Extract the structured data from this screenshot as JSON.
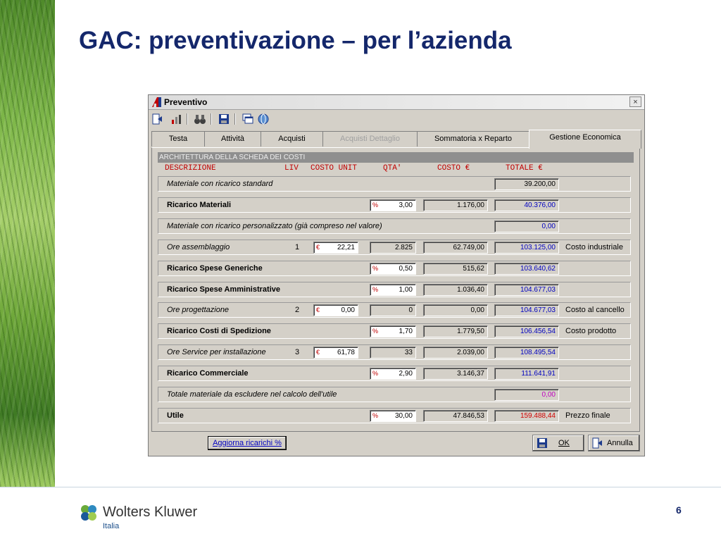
{
  "slide": {
    "title": "GAC: preventivazione – per l’azienda",
    "page_number": "6",
    "logo": {
      "name": "Wolters Kluwer",
      "subtitle": "Italia"
    }
  },
  "window": {
    "title": "Preventivo",
    "close_label": "×",
    "toolbar_icons": [
      "exit-icon",
      "chart-icon",
      "binoculars-icon",
      "save-icon",
      "windows-icon",
      "globe-icon"
    ]
  },
  "tabs": [
    {
      "label": "Testa",
      "state": "normal"
    },
    {
      "label": "Attività",
      "state": "normal"
    },
    {
      "label": "Acquisti",
      "state": "normal"
    },
    {
      "label": "Acquisti Dettaglio",
      "state": "disabled"
    },
    {
      "label": "Sommatoria x Reparto",
      "state": "normal"
    },
    {
      "label": "Gestione Economica",
      "state": "active"
    }
  ],
  "section": {
    "title": "ARCHITETTURA DELLA SCHEDA DEI COSTI",
    "headers": {
      "descrizione": "DESCRIZIONE",
      "liv": "LIV",
      "costo_unit": "COSTO UNIT",
      "qta": "QTA'",
      "costo": "COSTO €",
      "totale": "TOTALE €"
    }
  },
  "rows": [
    {
      "label": "Materiale con ricarico standard",
      "style": "italic",
      "totale": "39.200,00",
      "totale_color": "black"
    },
    {
      "label": "Ricarico Materiali",
      "style": "bold",
      "unit": "%",
      "qta": "3,00",
      "costo": "1.176,00",
      "totale": "40.376,00",
      "totale_color": "blue"
    },
    {
      "label": "Materiale con ricarico personalizzato (già compreso nel valore)",
      "style": "italic",
      "totale": "0,00",
      "totale_color": "blue"
    },
    {
      "label": "Ore assemblaggio",
      "style": "italic",
      "liv": "1",
      "unit": "€",
      "costo_unit": "22,21",
      "qta": "2.825",
      "costo": "62.749,00",
      "totale": "103.125,00",
      "totale_color": "blue",
      "note": "Costo industriale"
    },
    {
      "label": "Ricarico Spese Generiche",
      "style": "bold",
      "unit": "%",
      "qta": "0,50",
      "costo": "515,62",
      "totale": "103.640,62",
      "totale_color": "blue"
    },
    {
      "label": "Ricarico Spese Amministrative",
      "style": "bold",
      "unit": "%",
      "qta": "1,00",
      "costo": "1.036,40",
      "totale": "104.677,03",
      "totale_color": "blue"
    },
    {
      "label": "Ore progettazione",
      "style": "italic",
      "liv": "2",
      "unit": "€",
      "costo_unit": "0,00",
      "qta": "0",
      "costo": "0,00",
      "totale": "104.677,03",
      "totale_color": "blue",
      "note": "Costo al cancello"
    },
    {
      "label": "Ricarico Costi di Spedizione",
      "style": "bold",
      "unit": "%",
      "qta": "1,70",
      "costo": "1.779,50",
      "totale": "106.456,54",
      "totale_color": "blue",
      "note": "Costo prodotto"
    },
    {
      "label": "Ore Service per installazione",
      "style": "italic",
      "liv": "3",
      "unit": "€",
      "costo_unit": "61,78",
      "qta": "33",
      "costo": "2.039,00",
      "totale": "108.495,54",
      "totale_color": "blue"
    },
    {
      "label": "Ricarico Commerciale",
      "style": "bold",
      "unit": "%",
      "qta": "2,90",
      "costo": "3.146,37",
      "totale": "111.641,91",
      "totale_color": "blue"
    },
    {
      "label": "Totale materiale da escludere nel calcolo dell'utile",
      "style": "italic",
      "totale": "0,00",
      "totale_color": "magenta"
    },
    {
      "label": "Utile",
      "style": "bold",
      "unit": "%",
      "qta": "30,00",
      "costo": "47.846,53",
      "totale": "159.488,44",
      "totale_color": "red",
      "note": "Prezzo finale"
    }
  ],
  "buttons": {
    "update": "Aggiorna ricarichi %",
    "ok": "OK",
    "cancel": "Annulla"
  }
}
